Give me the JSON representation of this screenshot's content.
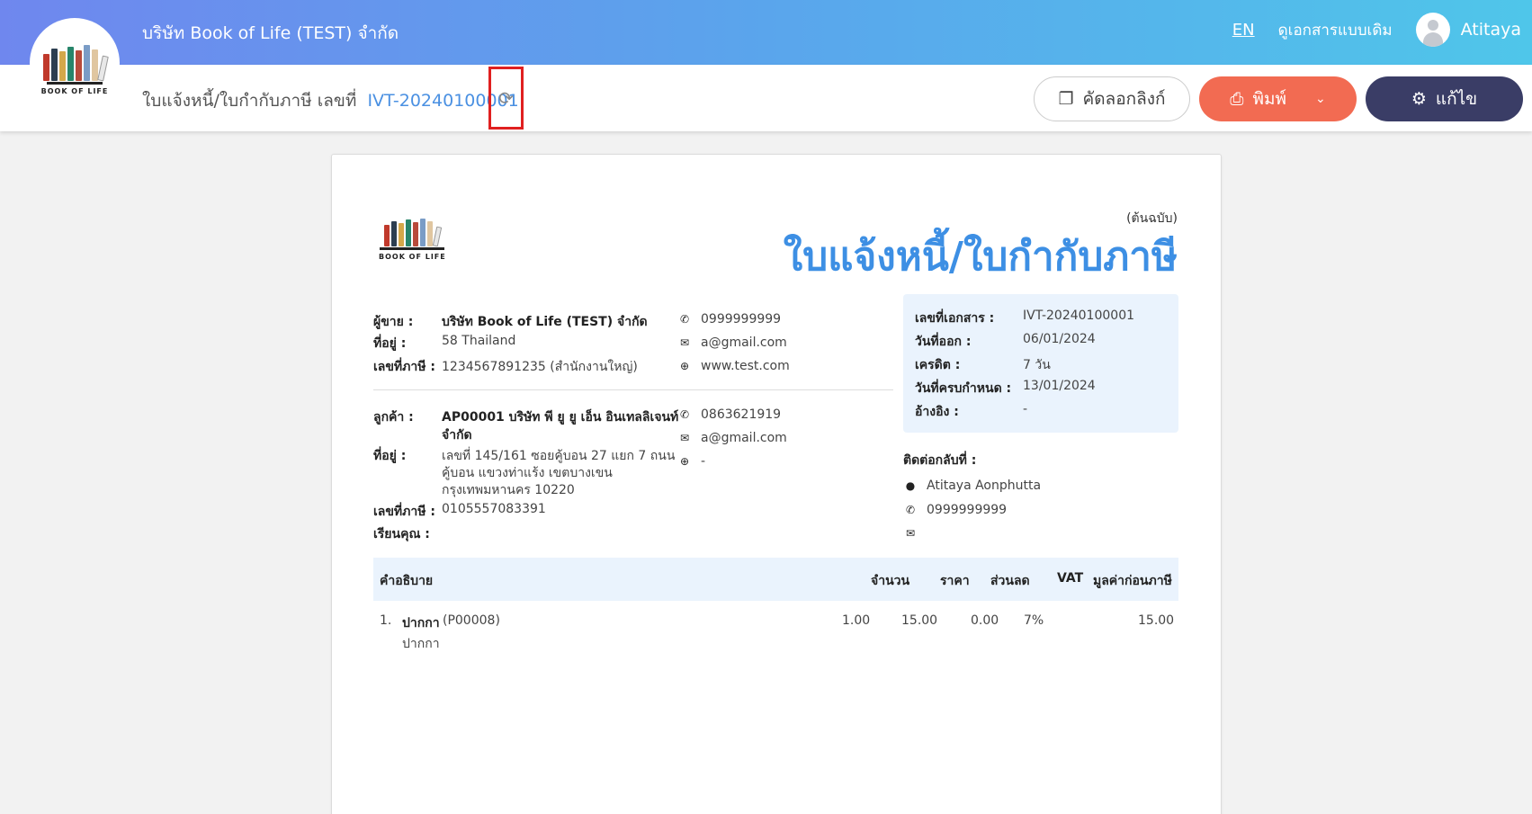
{
  "header": {
    "company_name": "บริษัท Book of Life (TEST) จำกัด",
    "lang": "EN",
    "legacy_view": "ดูเอกสารแบบเดิม",
    "user_name": "Atitaya"
  },
  "logo": {
    "text": "BOOK OF LIFE"
  },
  "toolbar": {
    "doc_type_prefix": "ใบแจ้งหนี้/ใบกำกับภาษี เลขที่",
    "doc_number": "IVT-20240100001",
    "copy_link": "คัดลอกลิงก์",
    "print": "พิมพ์",
    "edit": "แก้ไข"
  },
  "document": {
    "copy_label": "(ต้นฉบับ)",
    "title": "ใบแจ้งหนี้/ใบกำกับภาษี",
    "seller": {
      "label": "ผู้ขาย :",
      "name": "บริษัท Book of Life (TEST) จำกัด",
      "address_label": "ที่อยู่ :",
      "address": "58 Thailand",
      "tax_label": "เลขที่ภาษี :",
      "tax_id": "1234567891235 (สำนักงานใหญ่)",
      "phone": "0999999999",
      "email": "a@gmail.com",
      "website": "www.test.com"
    },
    "customer": {
      "label": "ลูกค้า :",
      "name_line1": "AP00001 บริษัท พี ยู ยู เอ็น อินเทลลิเจนท์",
      "name_line2": "จำกัด",
      "address_label": "ที่อยู่ :",
      "address_line1": "เลขที่ 145/161 ซอยคู้บอน 27 แยก 7 ถนน",
      "address_line2": "คู้บอน แขวงท่าแร้ง เขตบางเขน",
      "address_line3": "กรุงเทพมหานคร 10220",
      "tax_label": "เลขที่ภาษี :",
      "tax_id": "0105557083391",
      "attn_label": "เรียนคุณ :",
      "phone": "0863621919",
      "email": "a@gmail.com",
      "website": "-"
    },
    "info": {
      "doc_no_label": "เลขที่เอกสาร :",
      "doc_no": "IVT-20240100001",
      "issue_label": "วันที่ออก :",
      "issue_date": "06/01/2024",
      "credit_label": "เครดิต :",
      "credit": "7 วัน",
      "due_label": "วันที่ครบกำหนด :",
      "due_date": "13/01/2024",
      "ref_label": "อ้างอิง :",
      "ref": "-"
    },
    "contact": {
      "label": "ติดต่อกลับที่ :",
      "name": "Atitaya Aonphutta",
      "phone": "0999999999"
    },
    "table": {
      "headers": {
        "description": "คำอธิบาย",
        "qty": "จำนวน",
        "price": "ราคา",
        "discount": "ส่วนลด",
        "vat": "VAT",
        "amount": "มูลค่าก่อนภาษี"
      },
      "rows": [
        {
          "index": "1.",
          "name": "ปากกา",
          "code": "(P00008)",
          "detail": "ปากกา",
          "qty": "1.00",
          "price": "15.00",
          "discount": "0.00",
          "vat": "7%",
          "amount": "15.00"
        }
      ]
    }
  }
}
